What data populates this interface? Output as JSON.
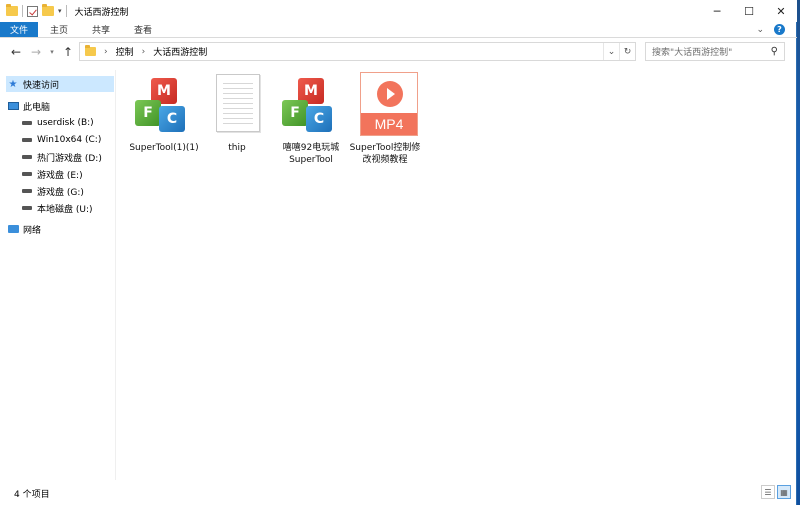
{
  "window": {
    "title": "大话西游控制",
    "controls": {
      "minimize": "─",
      "maximize": "☐",
      "close": "✕"
    }
  },
  "ribbon": {
    "tabs": [
      "文件",
      "主页",
      "共享",
      "查看"
    ],
    "expand_glyph": "⌄",
    "help_glyph": "?"
  },
  "address": {
    "back": "←",
    "forward": "→",
    "recent": "▾",
    "up": "↑",
    "breadcrumbs": [
      "控制",
      "大话西游控制"
    ],
    "dropdown_glyph": "⌄",
    "refresh_glyph": "↻",
    "search_placeholder": "搜索\"大话西游控制\"",
    "search_glyph": "⚲"
  },
  "nav": {
    "quick_access": "快速访问",
    "this_pc": "此电脑",
    "drives": [
      {
        "label": "userdisk (B:)"
      },
      {
        "label": "Win10x64 (C:)"
      },
      {
        "label": "热门游戏盘 (D:)"
      },
      {
        "label": "游戏盘 (E:)"
      },
      {
        "label": "游戏盘 (G:)"
      },
      {
        "label": "本地磁盘 (U:)"
      }
    ],
    "network": "网络"
  },
  "files": [
    {
      "name": "SuperTool(1)(1)",
      "icon": "mfc-app-icon"
    },
    {
      "name": "thip",
      "icon": "text-document-icon"
    },
    {
      "name": "嘻嘻92电玩城 SuperTool",
      "icon": "mfc-app-icon"
    },
    {
      "name": "SuperTool控制修改视频教程",
      "icon": "mp4-video-icon",
      "badge": "MP4"
    }
  ],
  "status": {
    "count": "4 个项目",
    "view_details": "☰",
    "view_icons": "▦"
  },
  "colors": {
    "accent": "#1979ca",
    "selection": "#cce8ff"
  }
}
